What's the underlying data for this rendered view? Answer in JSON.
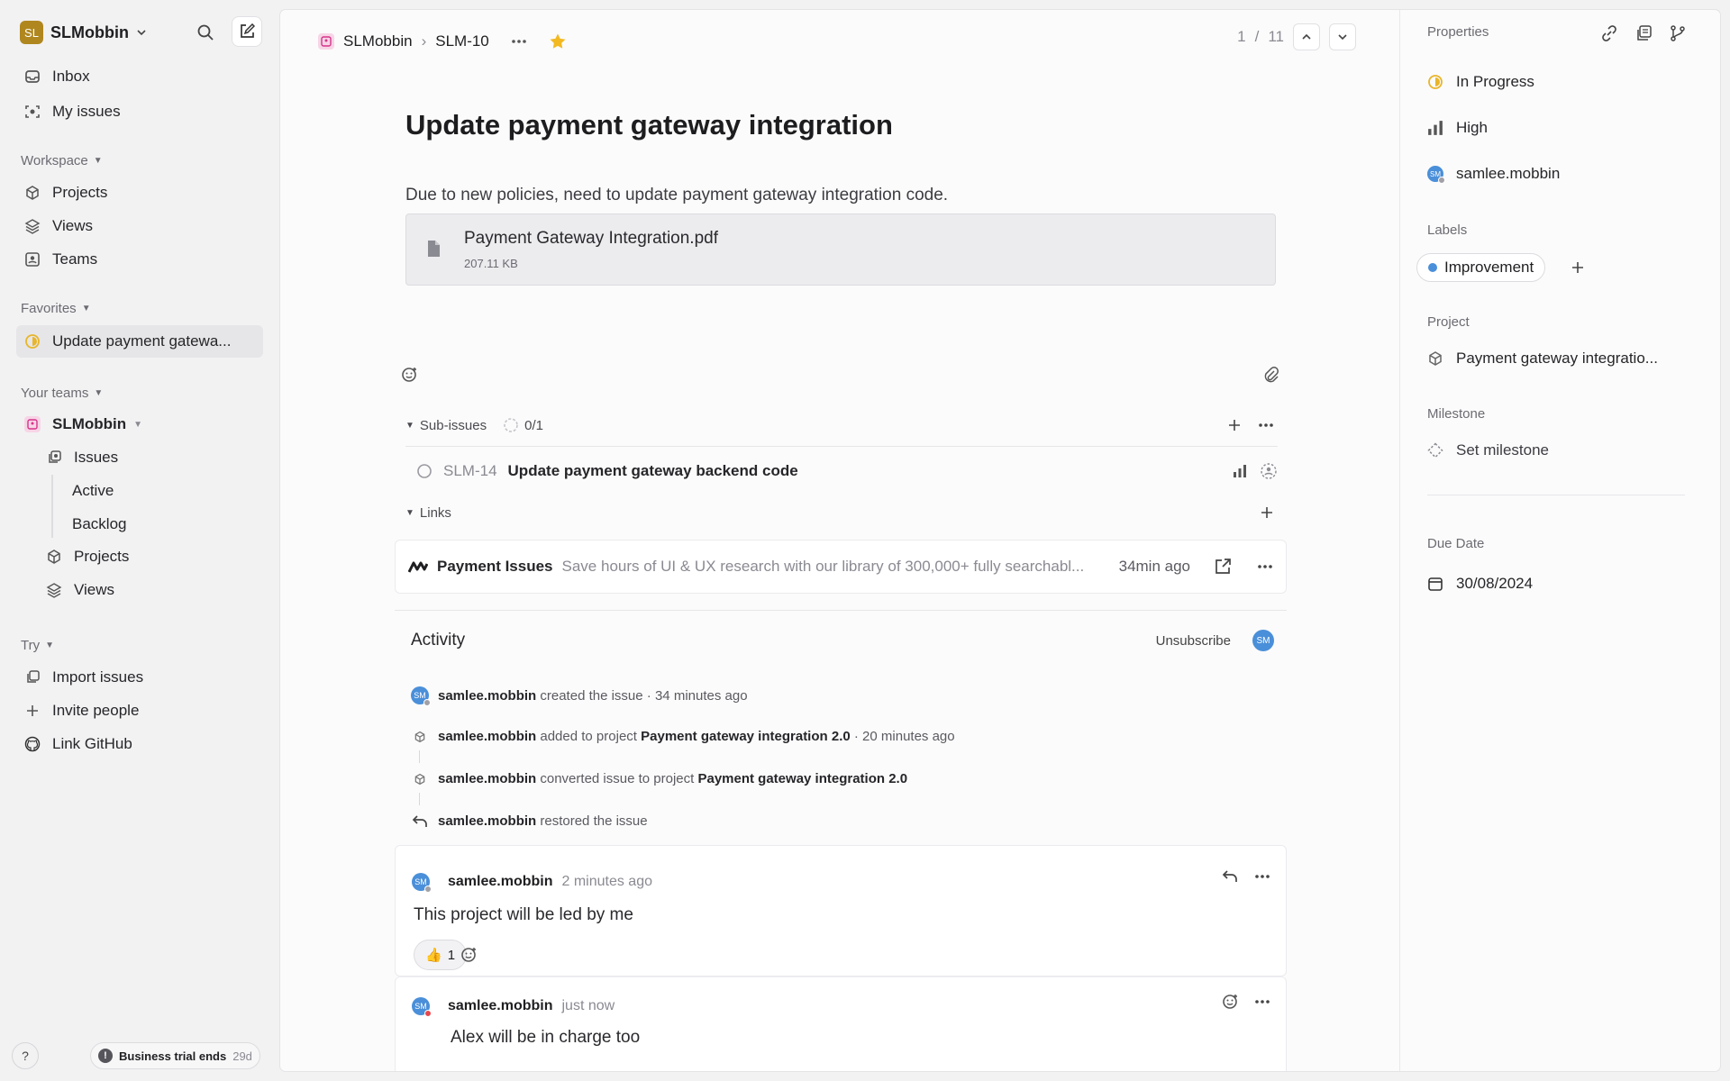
{
  "sidebar": {
    "workspace_initials": "SL",
    "workspace_name": "SLMobbin",
    "inbox": "Inbox",
    "my_issues": "My issues",
    "workspace_section": "Workspace",
    "projects": "Projects",
    "views": "Views",
    "teams": "Teams",
    "favorites_section": "Favorites",
    "favorite_item": "Update payment gatewa...",
    "your_teams_section": "Your teams",
    "team_name": "SLMobbin",
    "team_issues": "Issues",
    "team_active": "Active",
    "team_backlog": "Backlog",
    "team_projects": "Projects",
    "team_views": "Views",
    "try_section": "Try",
    "import_issues": "Import issues",
    "invite_people": "Invite people",
    "link_github": "Link GitHub",
    "help": "?",
    "trial_label": "Business trial ends",
    "trial_days": "29d"
  },
  "header": {
    "team": "SLMobbin",
    "issue_id": "SLM-10",
    "pager_current": "1",
    "pager_sep": "/",
    "pager_total": "11"
  },
  "issue": {
    "title": "Update payment gateway integration",
    "description": "Due to new policies, need to update payment gateway integration code.",
    "attachment_name": "Payment Gateway Integration.pdf",
    "attachment_size": "207.11 KB"
  },
  "subissues": {
    "label": "Sub-issues",
    "progress": "0/1",
    "items": [
      {
        "id": "SLM-14",
        "title": "Update payment gateway backend code"
      }
    ]
  },
  "links": {
    "label": "Links",
    "items": [
      {
        "title": "Payment Issues",
        "description": "Save hours of UI & UX research with our library of 300,000+ fully searchabl...",
        "time": "34min ago"
      }
    ]
  },
  "activity": {
    "heading": "Activity",
    "unsubscribe": "Unsubscribe",
    "avatar_initials": "SM",
    "events": [
      {
        "user": "samlee.mobbin",
        "text": "created the issue",
        "sep": "·",
        "time": "34 minutes ago"
      },
      {
        "user": "samlee.mobbin",
        "text": "added to project",
        "project": "Payment gateway integration 2.0",
        "sep": "·",
        "time": "20 minutes ago"
      },
      {
        "user": "samlee.mobbin",
        "text": "converted issue to project",
        "project": "Payment gateway integration 2.0"
      },
      {
        "user": "samlee.mobbin",
        "text": "restored the issue"
      }
    ],
    "comments": [
      {
        "user": "samlee.mobbin",
        "time": "2 minutes ago",
        "body": "This project will be led by me",
        "reaction_emoji": "👍",
        "reaction_count": "1"
      },
      {
        "user": "samlee.mobbin",
        "time": "just now",
        "body": "Alex will be in charge too"
      }
    ]
  },
  "properties": {
    "heading": "Properties",
    "status": "In Progress",
    "priority": "High",
    "assignee": "samlee.mobbin",
    "labels_heading": "Labels",
    "label": "Improvement",
    "project_heading": "Project",
    "project": "Payment gateway integratio...",
    "milestone_heading": "Milestone",
    "milestone": "Set milestone",
    "due_heading": "Due Date",
    "due_date": "30/08/2024"
  },
  "colors": {
    "in_progress": "#e8b52b",
    "avatar": "#4a8fd9",
    "label_dot": "#4a8fd9",
    "star": "#f2b922",
    "team_icon_bg": "#f7d5e6"
  }
}
